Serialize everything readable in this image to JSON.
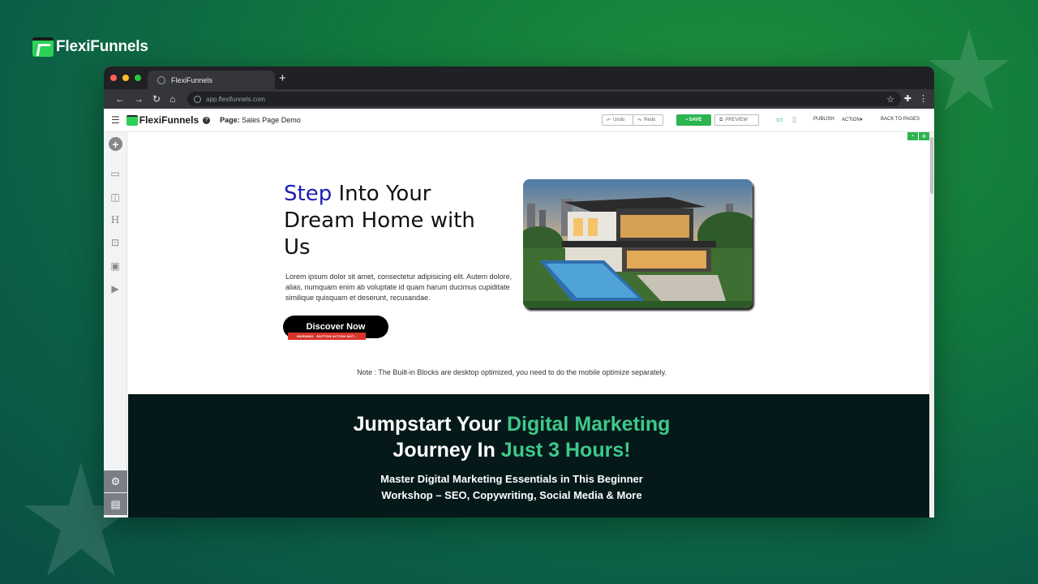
{
  "brand": {
    "name": "FlexiFunnels"
  },
  "browser": {
    "tab_title": "FlexiFunnels",
    "new_tab": "+",
    "url": "app.flexifunnels.com"
  },
  "editor": {
    "logo_text": "FlexiFunnels",
    "help": "?",
    "page_prefix": "Page:",
    "page_name": "Sales Page Demo",
    "undo": "Undo",
    "redo": "Redo",
    "save": "SAVE",
    "preview": "PREVIEW",
    "publish": "PUBLISH",
    "action": "ACTION",
    "back": "BACK TO PAGES"
  },
  "hero": {
    "headline_accent": "Step",
    "headline_rest": "Into Your Dream Home with Us",
    "body": "Lorem ipsum dolor sit amet, consectetur adipisicing elit. Autem dolore, alias, numquam enim ab voluptate id quam harum ducimus cupiditate similique quisquam et deserunt, recusandae.",
    "cta": "Discover Now",
    "warning": "WARNING - BUTTON ACTION NOT..."
  },
  "note": "Note : The Built-in Blocks are desktop optimized, you need to do the mobile optimize separately.",
  "workshop": {
    "h1_a": "Jumpstart Your ",
    "h1_b": "Digital Marketing",
    "h2_a": "Journey In ",
    "h2_b": "Just 3 Hours!",
    "sub1": "Master Digital Marketing Essentials in This Beginner",
    "sub2": "Workshop – SEO, Copywriting, Social Media & More"
  },
  "colors": {
    "accent_green": "#2bd157",
    "headline_blue": "#1d1db3",
    "section_dark": "#06191a",
    "highlight_green": "#3ec98a"
  }
}
